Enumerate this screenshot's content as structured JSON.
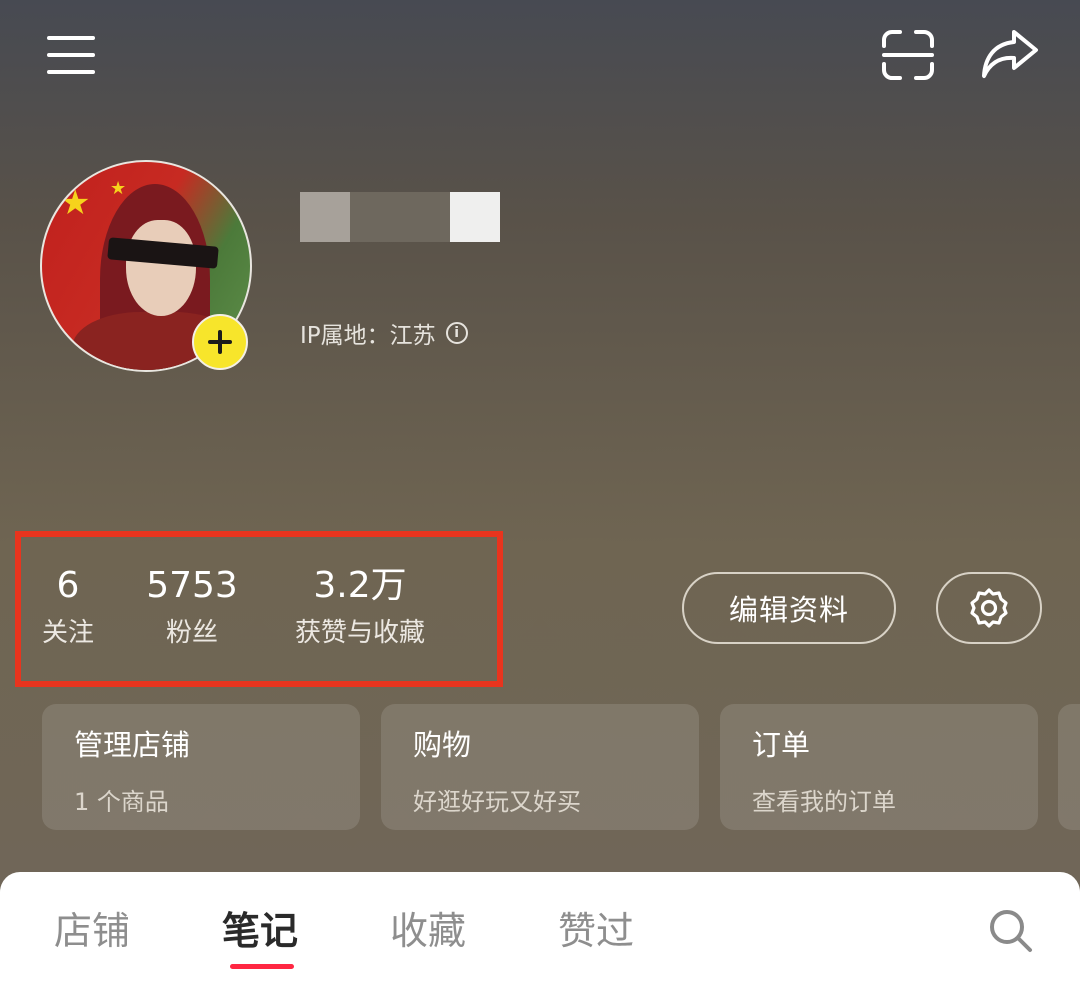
{
  "profile": {
    "ip_location": "IP属地：江苏"
  },
  "stats": [
    {
      "value": "6",
      "label": "关注"
    },
    {
      "value": "5753",
      "label": "粉丝"
    },
    {
      "value": "3.2万",
      "label": "获赞与收藏"
    }
  ],
  "actions": {
    "edit_profile": "编辑资料"
  },
  "cards": [
    {
      "title": "管理店铺",
      "subtitle": "1 个商品"
    },
    {
      "title": "购物",
      "subtitle": "好逛好玩又好买"
    },
    {
      "title": "订单",
      "subtitle": "查看我的订单"
    }
  ],
  "tabs": [
    {
      "label": "店铺"
    },
    {
      "label": "笔记"
    },
    {
      "label": "收藏"
    },
    {
      "label": "赞过"
    }
  ],
  "active_tab": "笔记",
  "colors": {
    "highlight_border": "#e8341e",
    "tab_underline": "#ff2742",
    "add_badge": "#f7e52b"
  },
  "icons": [
    "menu-icon",
    "scan-icon",
    "share-icon",
    "plus-icon",
    "info-icon",
    "settings-icon",
    "search-icon"
  ]
}
